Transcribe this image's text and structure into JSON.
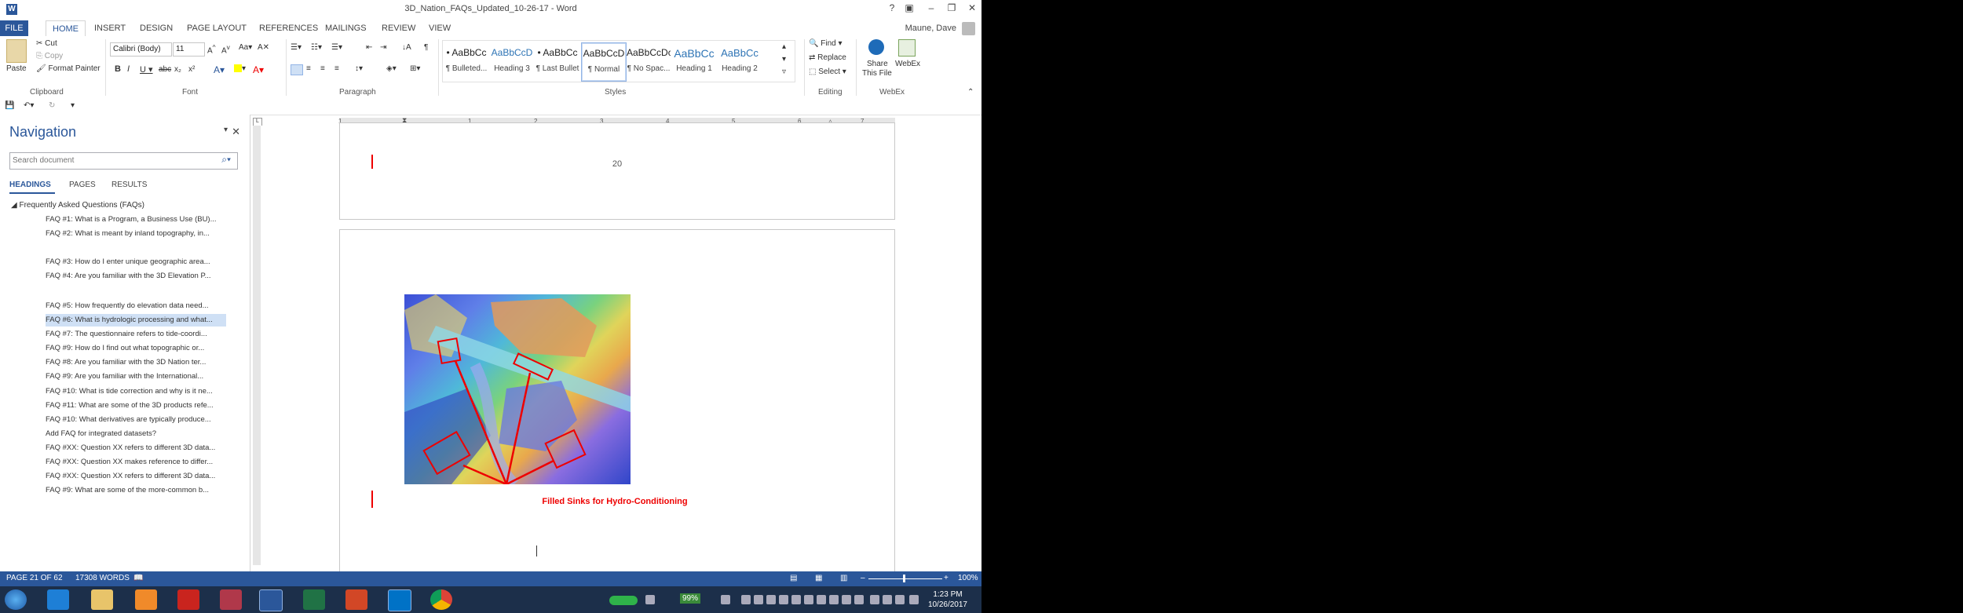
{
  "window": {
    "title": "3D_Nation_FAQs_Updated_10-26-17 - Word",
    "user": "Maune, Dave"
  },
  "ribbon_tabs": [
    "FILE",
    "HOME",
    "INSERT",
    "DESIGN",
    "PAGE LAYOUT",
    "REFERENCES",
    "MAILINGS",
    "REVIEW",
    "VIEW"
  ],
  "clipboard": {
    "paste": "Paste",
    "cut": "Cut",
    "copy": "Copy",
    "format_painter": "Format Painter",
    "label": "Clipboard"
  },
  "font": {
    "name": "Calibri (Body)",
    "size": "11",
    "label": "Font"
  },
  "paragraph": {
    "label": "Paragraph"
  },
  "styles": {
    "label": "Styles",
    "items": [
      {
        "preview": "• AaBbCc",
        "name": "¶ Bulleted..."
      },
      {
        "preview": "AaBbCcD",
        "name": "Heading 3"
      },
      {
        "preview": "• AaBbCc",
        "name": "¶ Last Bullet"
      },
      {
        "preview": "AaBbCcD",
        "name": "¶ Normal"
      },
      {
        "preview": "AaBbCcDc",
        "name": "¶ No Spac..."
      },
      {
        "preview": "AaBbCc",
        "name": "Heading 1"
      },
      {
        "preview": "AaBbCc",
        "name": "Heading 2"
      }
    ]
  },
  "editing": {
    "find": "Find",
    "replace": "Replace",
    "select": "Select",
    "label": "Editing"
  },
  "share": {
    "label1": "Share",
    "label2": "This File"
  },
  "webex": {
    "label": "WebEx",
    "group": "WebEx"
  },
  "navigation": {
    "title": "Navigation",
    "search_placeholder": "Search document",
    "tabs": [
      "HEADINGS",
      "PAGES",
      "RESULTS"
    ],
    "root": "Frequently Asked Questions (FAQs)",
    "items": [
      "FAQ #1: What is a Program, a Business Use (BU)...",
      "FAQ #2: What is meant by inland topography, in...",
      "FAQ #3: How do I enter unique geographic area...",
      "FAQ #4: Are you familiar with the 3D Elevation P...",
      "FAQ #5: How frequently do elevation data need...",
      "FAQ #6: What is hydrologic processing and what...",
      "FAQ #7:  The questionnaire refers to tide-coordi...",
      "FAQ #9: How do I find out what topographic or...",
      "FAQ #8: Are you familiar with the 3D Nation ter...",
      "FAQ #9: Are you familiar with the International...",
      "FAQ #10: What is tide correction and why is it ne...",
      "FAQ #11: What are some of the 3D products refe...",
      "FAQ #10: What derivatives are typically produce...",
      "Add FAQ for integrated datasets?",
      "FAQ #XX: Question XX refers to different 3D data...",
      "FAQ #XX: Question XX makes reference to differ...",
      "FAQ #XX: Question XX refers to different 3D data...",
      "FAQ #9: What are some of the more-common b..."
    ],
    "selected_index": 5
  },
  "ruler": {
    "ticks": [
      "1",
      "1",
      "2",
      "3",
      "4",
      "5",
      "6",
      "7"
    ]
  },
  "document": {
    "page_number": "20",
    "caption": "Filled Sinks for Hydro-Conditioning"
  },
  "status": {
    "page": "PAGE 21 OF 62",
    "words": "17308 WORDS",
    "zoom": "100%"
  },
  "taskbar": {
    "battery": "99%",
    "time": "1:23 PM",
    "date": "10/26/2017"
  },
  "colors": {
    "accent": "#2b579a",
    "caption": "#ee0000"
  }
}
